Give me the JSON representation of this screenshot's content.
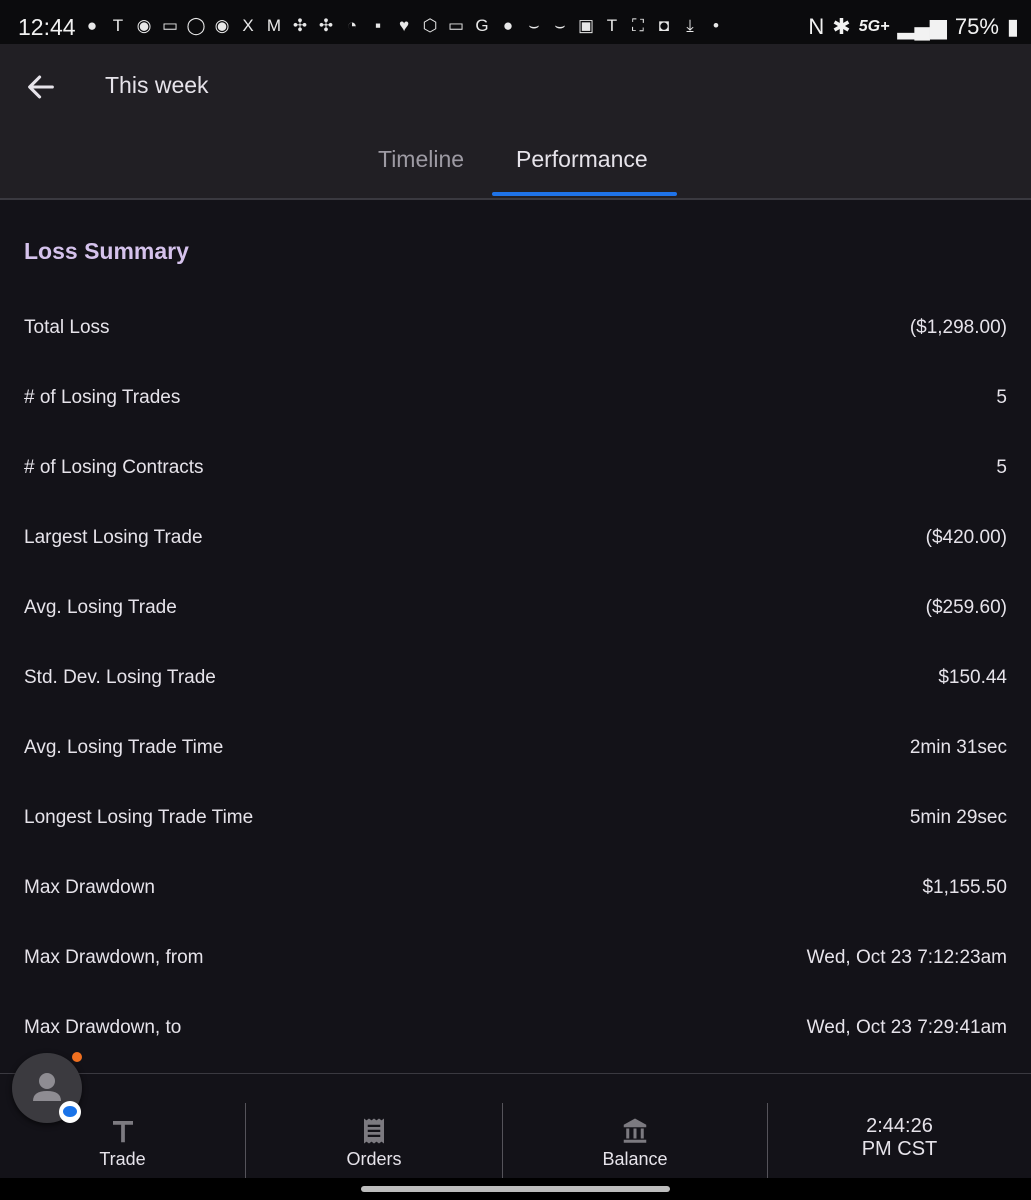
{
  "status_bar": {
    "time": "12:44",
    "network": "5G+",
    "battery": "75%",
    "icons": [
      "chat-bubble-icon",
      "tesla-icon",
      "amex-icon",
      "card-icon",
      "adt-icon",
      "amex-icon",
      "x-icon",
      "gmail-icon",
      "pinwheel-icon",
      "pinwheel-icon",
      "clock-icon",
      "apps-icon",
      "heart-icon",
      "pocket-icon",
      "card-icon",
      "google-icon",
      "chat-bubble-icon",
      "amazon-icon",
      "amazon-icon",
      "gallery-icon",
      "tesla-icon",
      "screenshot-icon",
      "bag-icon",
      "download-icon",
      "dot-icon"
    ],
    "right_icons": [
      "nfc-icon",
      "bluetooth-icon",
      "signal-icon",
      "battery-icon"
    ]
  },
  "app_bar": {
    "title": "This week",
    "tabs": [
      {
        "label": "Timeline",
        "selected": false
      },
      {
        "label": "Performance",
        "selected": true
      }
    ],
    "accent": "#1f73e8"
  },
  "loss_summary": {
    "title": "Loss Summary",
    "title_color": "#d5c2ec",
    "rows": [
      {
        "label": "Total Loss",
        "value": "($1,298.00)"
      },
      {
        "label": "# of Losing Trades",
        "value": "5"
      },
      {
        "label": "# of Losing Contracts",
        "value": "5"
      },
      {
        "label": "Largest Losing Trade",
        "value": "($420.00)"
      },
      {
        "label": "Avg. Losing Trade",
        "value": "($259.60)"
      },
      {
        "label": "Std. Dev. Losing Trade",
        "value": "$150.44"
      },
      {
        "label": "Avg. Losing Trade Time",
        "value": "2min 31sec"
      },
      {
        "label": "Longest Losing Trade Time",
        "value": "5min 29sec"
      },
      {
        "label": "Max Drawdown",
        "value": "$1,155.50"
      },
      {
        "label": "Max Drawdown, from",
        "value": "Wed, Oct 23 7:12:23am"
      },
      {
        "label": "Max Drawdown, to",
        "value": "Wed, Oct 23 7:29:41am"
      }
    ]
  },
  "bottom_nav": {
    "items": [
      {
        "label": "Trade",
        "icon": "trade-t-icon"
      },
      {
        "label": "Orders",
        "icon": "receipt-icon"
      },
      {
        "label": "Balance",
        "icon": "bank-icon"
      }
    ],
    "clock_line1": "2:44:26",
    "clock_line2": "PM CST"
  }
}
